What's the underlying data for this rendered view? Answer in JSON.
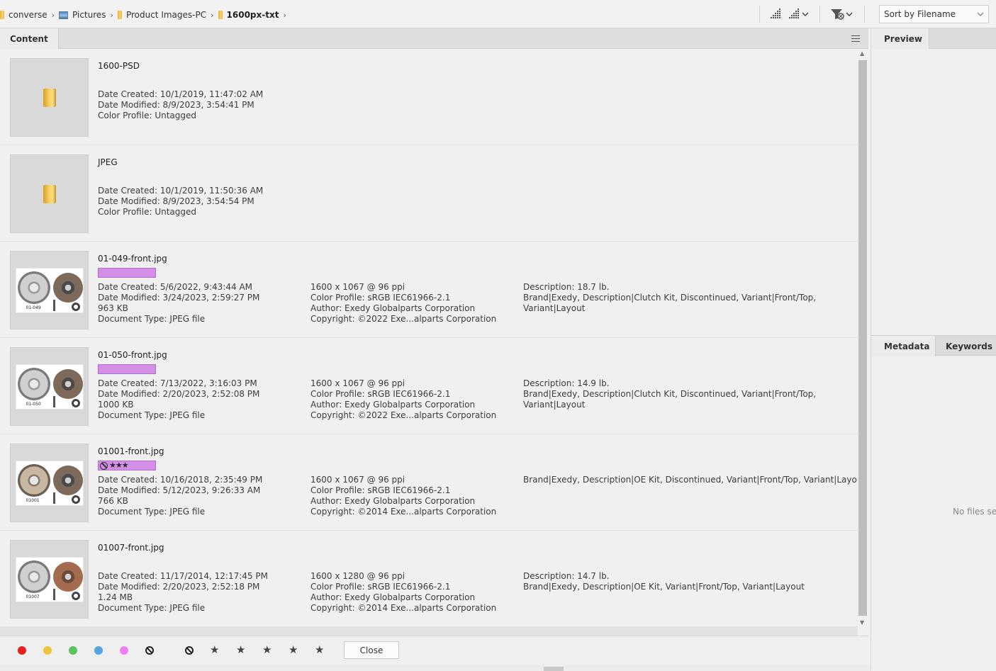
{
  "breadcrumb": [
    {
      "label": "converse",
      "icon": "folder-icon"
    },
    {
      "label": "Pictures",
      "icon": "pictures-icon"
    },
    {
      "label": "Product Images-PC",
      "icon": "folder-icon"
    },
    {
      "label": "1600px-txt",
      "icon": "folder-icon"
    }
  ],
  "toolbar": {
    "sort_label": "Sort by Filename"
  },
  "content_panel": {
    "tab_label": "Content"
  },
  "items": [
    {
      "filename": "1600-PSD",
      "kind": "folder",
      "col1": [
        "Date Created: 10/1/2019, 11:47:02 AM",
        "Date Modified: 8/9/2023, 3:54:41 PM",
        "Color Profile: Untagged"
      ],
      "col2": [],
      "col3": []
    },
    {
      "filename": "JPEG",
      "kind": "folder",
      "col1": [
        "Date Created: 10/1/2019, 11:50:36 AM",
        "Date Modified: 8/9/2023, 3:54:54 PM",
        "Color Profile: Untagged"
      ],
      "col2": [],
      "col3": []
    },
    {
      "filename": "01-049-front.jpg",
      "kind": "image",
      "label_color": "#d38ee6",
      "caption": "01-049",
      "col1": [
        "Date Created: 5/6/2022, 9:43:44 AM",
        "Date Modified: 3/24/2023, 2:59:27 PM",
        "963 KB",
        "Document Type: JPEG file"
      ],
      "col2": [
        "1600 x 1067 @ 96 ppi",
        "Color Profile: sRGB IEC61966-2.1",
        "Author: Exedy Globalparts Corporation",
        "Copyright: ©2022 Exe...alparts Corporation"
      ],
      "col3": [
        "Description: 18.7 lb.",
        "Brand|Exedy, Description|Clutch Kit, Discontinued, Variant|Front/Top,",
        "Variant|Layout"
      ]
    },
    {
      "filename": "01-050-front.jpg",
      "kind": "image",
      "label_color": "#d38ee6",
      "caption": "01-050",
      "col1": [
        "Date Created: 7/13/2022, 3:16:03 PM",
        "Date Modified: 2/20/2023, 2:52:08 PM",
        "1000 KB",
        "Document Type: JPEG file"
      ],
      "col2": [
        "1600 x 1067 @ 96 ppi",
        "Color Profile: sRGB IEC61966-2.1",
        "Author: Exedy Globalparts Corporation",
        "Copyright: ©2022 Exe...alparts Corporation"
      ],
      "col3": [
        "Description: 14.9 lb.",
        "Brand|Exedy, Description|Clutch Kit, Discontinued, Variant|Front/Top,",
        "Variant|Layout"
      ]
    },
    {
      "filename": "01001-front.jpg",
      "kind": "image",
      "label_color": "#d38ee6",
      "rating": "★★★",
      "rejected": true,
      "caption": "01001",
      "col1": [
        "Date Created: 10/16/2018, 2:35:49 PM",
        "Date Modified: 5/12/2023, 9:26:33 AM",
        "766 KB",
        "Document Type: JPEG file"
      ],
      "col2": [
        "1600 x 1067 @ 96 ppi",
        "Color Profile: sRGB IEC61966-2.1",
        "Author: Exedy Globalparts Corporation",
        "Copyright: ©2014 Exe...alparts Corporation"
      ],
      "col3": [
        "Brand|Exedy, Description|OE Kit, Discontinued, Variant|Front/Top, Variant|Layout"
      ]
    },
    {
      "filename": "01007-front.jpg",
      "kind": "image",
      "caption": "01007",
      "col1": [
        "Date Created: 11/17/2014, 12:17:45 PM",
        "Date Modified: 2/20/2023, 2:52:18 PM",
        "1.24 MB",
        "Document Type: JPEG file"
      ],
      "col2": [
        "1600 x 1280 @ 96 ppi",
        "Color Profile: sRGB IEC61966-2.1",
        "Author: Exedy Globalparts Corporation",
        "Copyright: ©2014 Exe...alparts Corporation"
      ],
      "col3": [
        "Description: 14.7 lb.",
        "Brand|Exedy, Description|OE Kit, Variant|Front/Top, Variant|Layout"
      ]
    }
  ],
  "bottom_bar": {
    "label_colors": [
      "#e81f1f",
      "#f0c33c",
      "#5cc45c",
      "#56a5e0",
      "#f07ef0"
    ],
    "stars": [
      "★",
      "★",
      "★",
      "★",
      "★"
    ],
    "close_label": "Close"
  },
  "preview_panel": {
    "tab_label": "Preview"
  },
  "metadata_panel": {
    "tabs": [
      "Metadata",
      "Keywords"
    ],
    "empty_text": "No files sele"
  }
}
